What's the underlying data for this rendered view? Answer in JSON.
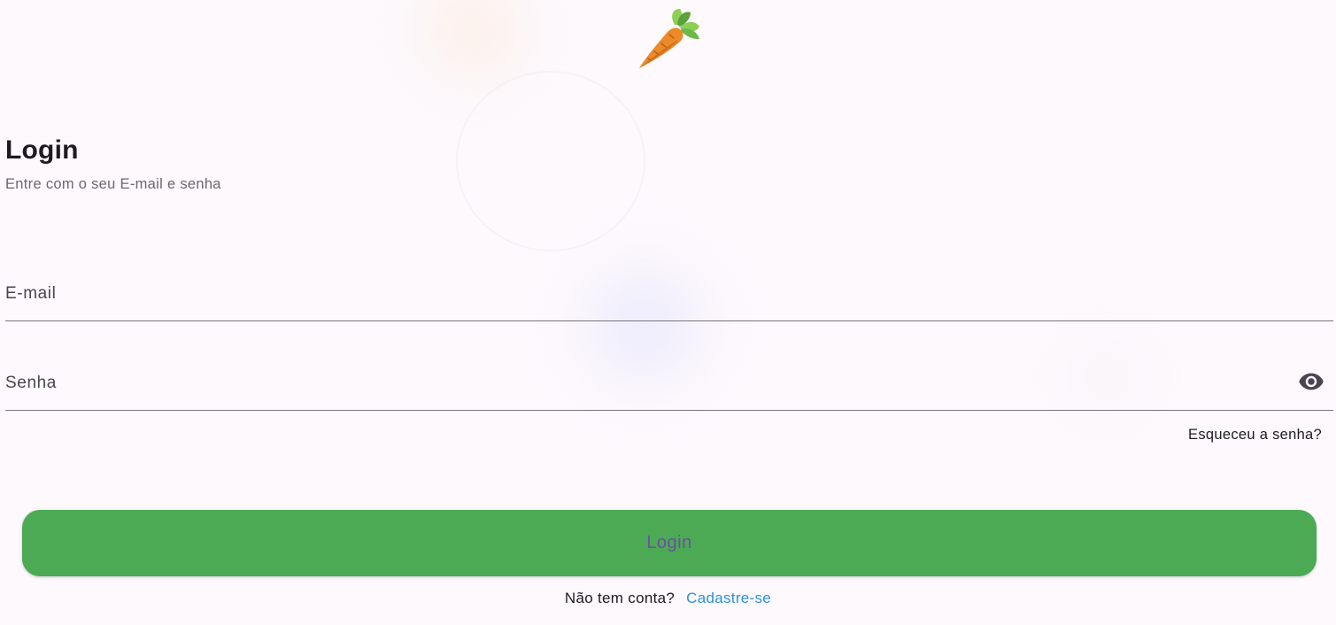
{
  "logo": {
    "icon": "carrot-icon"
  },
  "header": {
    "title": "Login",
    "subtitle": "Entre com o seu E-mail e senha"
  },
  "form": {
    "email_placeholder": "E-mail",
    "password_placeholder": "Senha",
    "visibility_icon": "eye-icon",
    "forgot_password": "Esqueceu a senha?",
    "submit_label": "Login"
  },
  "footer": {
    "prompt": "Não tem conta?",
    "signup_link": "Cadastre-se"
  },
  "colors": {
    "background": "#fdf9fd",
    "button": "#4caa55",
    "button_text": "#6a4fa2",
    "link": "#2f8fd8"
  }
}
